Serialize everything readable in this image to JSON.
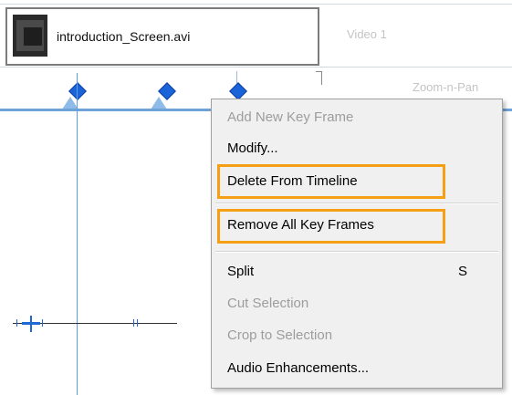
{
  "timeline": {
    "clip": {
      "filename": "introduction_Screen.avi"
    },
    "tracks": {
      "video_label": "Video 1",
      "zoom_label": "Zoom-n-Pan"
    }
  },
  "context_menu": {
    "items": [
      {
        "label": "Add New Key Frame",
        "enabled": false
      },
      {
        "label": "Modify...",
        "enabled": true
      },
      {
        "label": "Delete From Timeline",
        "enabled": true,
        "highlighted": true
      },
      {
        "label": "Remove All Key Frames",
        "enabled": true,
        "highlighted": true
      },
      {
        "label": "Split",
        "shortcut": "S",
        "enabled": true
      },
      {
        "label": "Cut Selection",
        "enabled": false
      },
      {
        "label": "Crop to Selection",
        "enabled": false
      },
      {
        "label": "Audio Enhancements...",
        "enabled": true
      }
    ]
  },
  "colors": {
    "highlight": "#f5a014",
    "keyframe": "#1a63d9",
    "playhead": "#5b9ee6"
  },
  "icons": [
    "keyframe-diamond-icon",
    "video-thumbnail",
    "audio-marker-icon"
  ]
}
